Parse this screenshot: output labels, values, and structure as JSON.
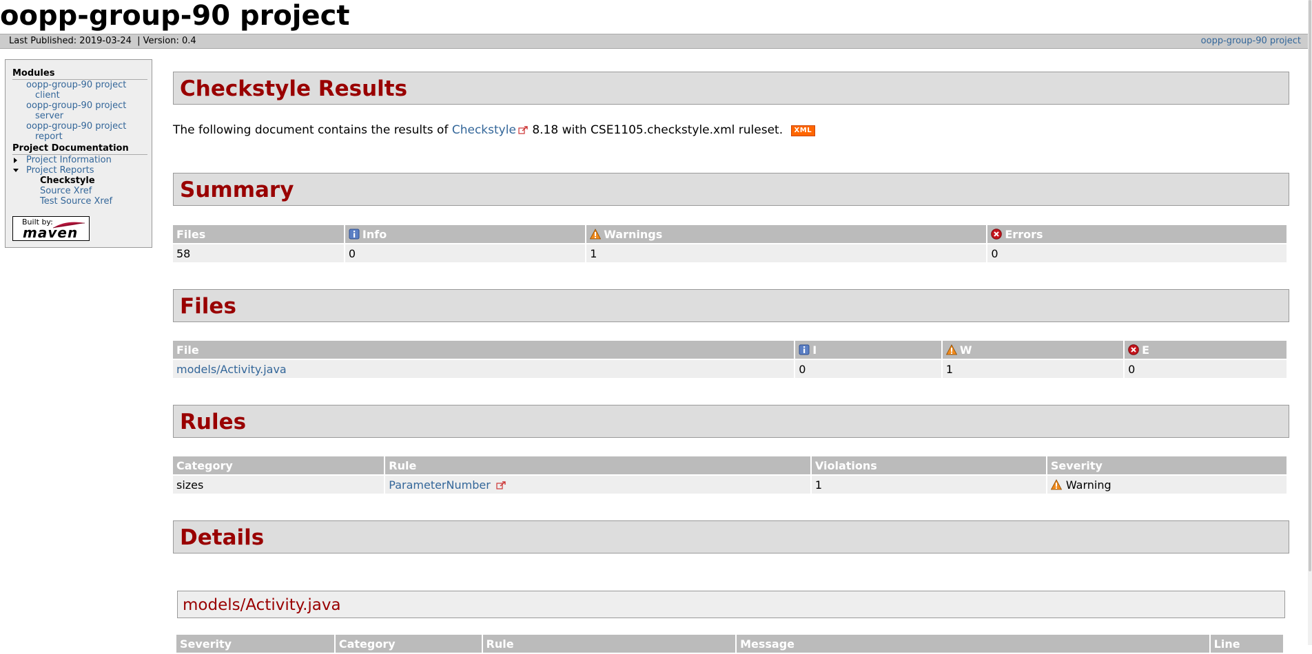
{
  "header": {
    "title": "oopp-group-90 project",
    "last_published": "Last Published: 2019-03-24",
    "version": "| Version: 0.4",
    "right_link": "oopp-group-90 project"
  },
  "nav": {
    "modules_heading": "Modules",
    "modules": [
      {
        "line1": "oopp-group-90 project",
        "line2": "client"
      },
      {
        "line1": "oopp-group-90 project",
        "line2": "server"
      },
      {
        "line1": "oopp-group-90 project",
        "line2": "report"
      }
    ],
    "docs_heading": "Project Documentation",
    "project_information": "Project Information",
    "project_reports": "Project Reports",
    "reports": [
      "Checkstyle",
      "Source Xref",
      "Test Source Xref"
    ],
    "built_by": "Built by:",
    "maven": "maven"
  },
  "main": {
    "title": "Checkstyle Results",
    "intro_before": "The following document contains the results of",
    "intro_link": "Checkstyle",
    "intro_after": "8.18 with CSE1105.checkstyle.xml ruleset.",
    "xml_badge": "XML",
    "summary": {
      "heading": "Summary",
      "headers": {
        "files": "Files",
        "info": "Info",
        "warnings": "Warnings",
        "errors": "Errors"
      },
      "values": {
        "files": "58",
        "info": "0",
        "warnings": "1",
        "errors": "0"
      }
    },
    "files": {
      "heading": "Files",
      "headers": {
        "file": "File",
        "i": "I",
        "w": "W",
        "e": "E"
      },
      "rows": [
        {
          "file": "models/Activity.java",
          "i": "0",
          "w": "1",
          "e": "0"
        }
      ]
    },
    "rules": {
      "heading": "Rules",
      "headers": {
        "category": "Category",
        "rule": "Rule",
        "violations": "Violations",
        "severity": "Severity"
      },
      "rows": [
        {
          "category": "sizes",
          "rule": "ParameterNumber",
          "violations": "1",
          "severity": "Warning"
        }
      ]
    },
    "details": {
      "heading": "Details",
      "file": "models/Activity.java",
      "headers": {
        "severity": "Severity",
        "category": "Category",
        "rule": "Rule",
        "message": "Message",
        "line": "Line"
      }
    }
  },
  "icons": {
    "info": "info-icon",
    "warning": "warning-icon",
    "error": "error-icon",
    "external": "external-link-icon"
  },
  "colors": {
    "heading": "#990000",
    "link": "#336699",
    "header_bg": "#bbbbbb",
    "row_bg": "#eeeeee",
    "section_bg": "#dddddd"
  }
}
